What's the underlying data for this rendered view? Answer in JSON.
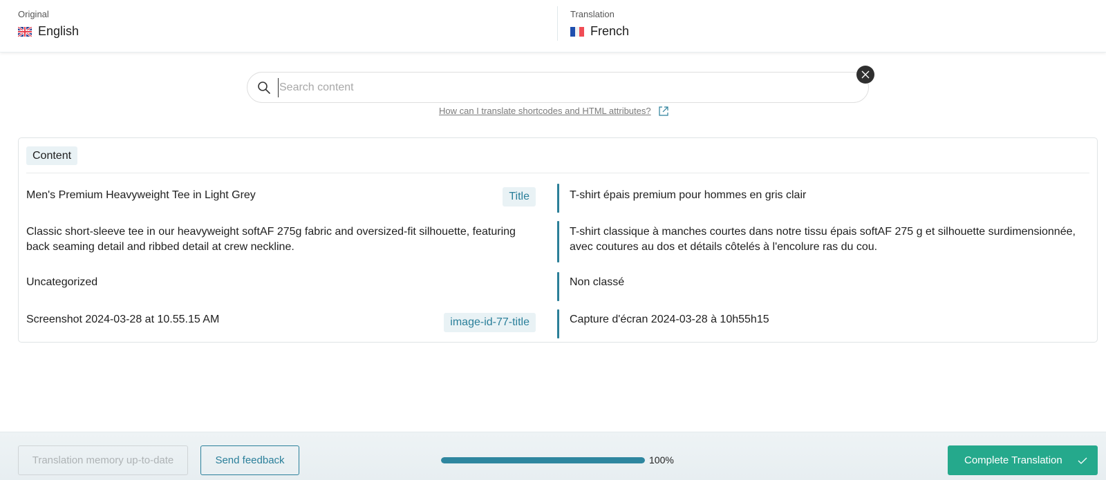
{
  "header": {
    "original": {
      "caption": "Original",
      "language": "English",
      "flag_icon": "uk-flag-icon"
    },
    "translation": {
      "caption": "Translation",
      "language": "French",
      "flag_icon": "france-flag-icon"
    }
  },
  "search": {
    "placeholder": "Search content",
    "value": "",
    "help_link": "How can I translate shortcodes and HTML attributes?"
  },
  "content": {
    "section_label": "Content",
    "rows": [
      {
        "source": "Men's Premium Heavyweight Tee in Light Grey",
        "tag": "Title",
        "target": "T-shirt épais premium pour hommes en gris clair"
      },
      {
        "source": "Classic short-sleeve tee in our heavyweight softAF 275g fabric and oversized-fit silhouette, featuring back seaming detail and ribbed detail at crew neckline.",
        "tag": "",
        "target": "T-shirt classique à manches courtes dans notre tissu épais softAF 275 g et silhouette surdimensionnée, avec coutures au dos et détails côtelés à l'encolure ras du cou."
      },
      {
        "source": "Uncategorized",
        "tag": "",
        "target": "Non classé"
      },
      {
        "source": "Screenshot 2024-03-28 at 10.55.15 AM",
        "tag": "image-id-77-title",
        "target": "Capture d'écran 2024-03-28 à 10h55h15"
      }
    ]
  },
  "footer": {
    "translation_memory_label": "Translation memory up-to-date",
    "feedback_label": "Send feedback",
    "progress_percent": 100,
    "progress_label": "100%",
    "complete_label": "Complete Translation"
  },
  "colors": {
    "accent": "#2a7f9a",
    "complete_button": "#25a98c",
    "progress_fill": "#2e869f"
  }
}
